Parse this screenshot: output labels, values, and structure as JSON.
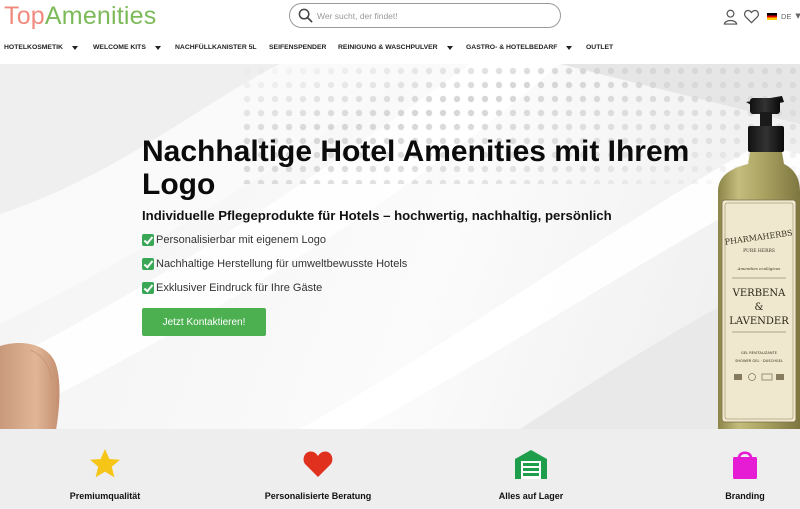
{
  "header": {
    "logo_part1": "Top",
    "logo_part2": "Amenities",
    "search_placeholder": "Wer sucht, der findet!",
    "language": "DE"
  },
  "nav": {
    "items": [
      {
        "label": "HOTELKOSMETIK",
        "has_dropdown": true
      },
      {
        "label": "WELCOME KITS",
        "has_dropdown": true
      },
      {
        "label": "NACHFÜLLKANISTER 5L",
        "has_dropdown": false
      },
      {
        "label": "SEIFENSPENDER",
        "has_dropdown": false
      },
      {
        "label": "REINIGUNG & WASCHPULVER",
        "has_dropdown": true
      },
      {
        "label": "GASTRO- & HOTELBEDARF",
        "has_dropdown": true
      },
      {
        "label": "OUTLET",
        "has_dropdown": false
      }
    ]
  },
  "hero": {
    "title": "Nachhaltige Hotel Amenities mit Ihrem Logo",
    "subtitle": "Individuelle Pflegeprodukte für Hotels – hochwertig, nachhaltig, persönlich",
    "checks": [
      "Personalisierbar mit eigenem Logo",
      "Nachhaltige Herstellung für umweltbewusste Hotels",
      "Exklusiver Eindruck für Ihre Gäste"
    ],
    "cta_label": "Jetzt Kontaktieren!",
    "bottle": {
      "brand": "PHARMAHERBS",
      "tagline": "PURE HERBS",
      "small_text": "Amenities ecológicos",
      "product_line1": "VERBENA",
      "product_line2": "&",
      "product_line3": "LAVENDER",
      "type_line1": "GEL REVITALIZANTE",
      "type_line2": "SHOWER GEL · DUSCHGEL"
    }
  },
  "features": {
    "items": [
      {
        "label": "Premiumqualität",
        "icon": "star-icon",
        "color": "#f5c518"
      },
      {
        "label": "Personalisierte Beratung",
        "icon": "heart-icon",
        "color": "#e0301e"
      },
      {
        "label": "Alles auf Lager",
        "icon": "warehouse-icon",
        "color": "#1e9e4a"
      },
      {
        "label": "Branding",
        "icon": "shopping-bag-icon",
        "color": "#e61bd4"
      }
    ]
  },
  "colors": {
    "brand_green": "#4caf50",
    "logo_coral": "#f08a7e",
    "logo_green": "#7cba5a"
  }
}
